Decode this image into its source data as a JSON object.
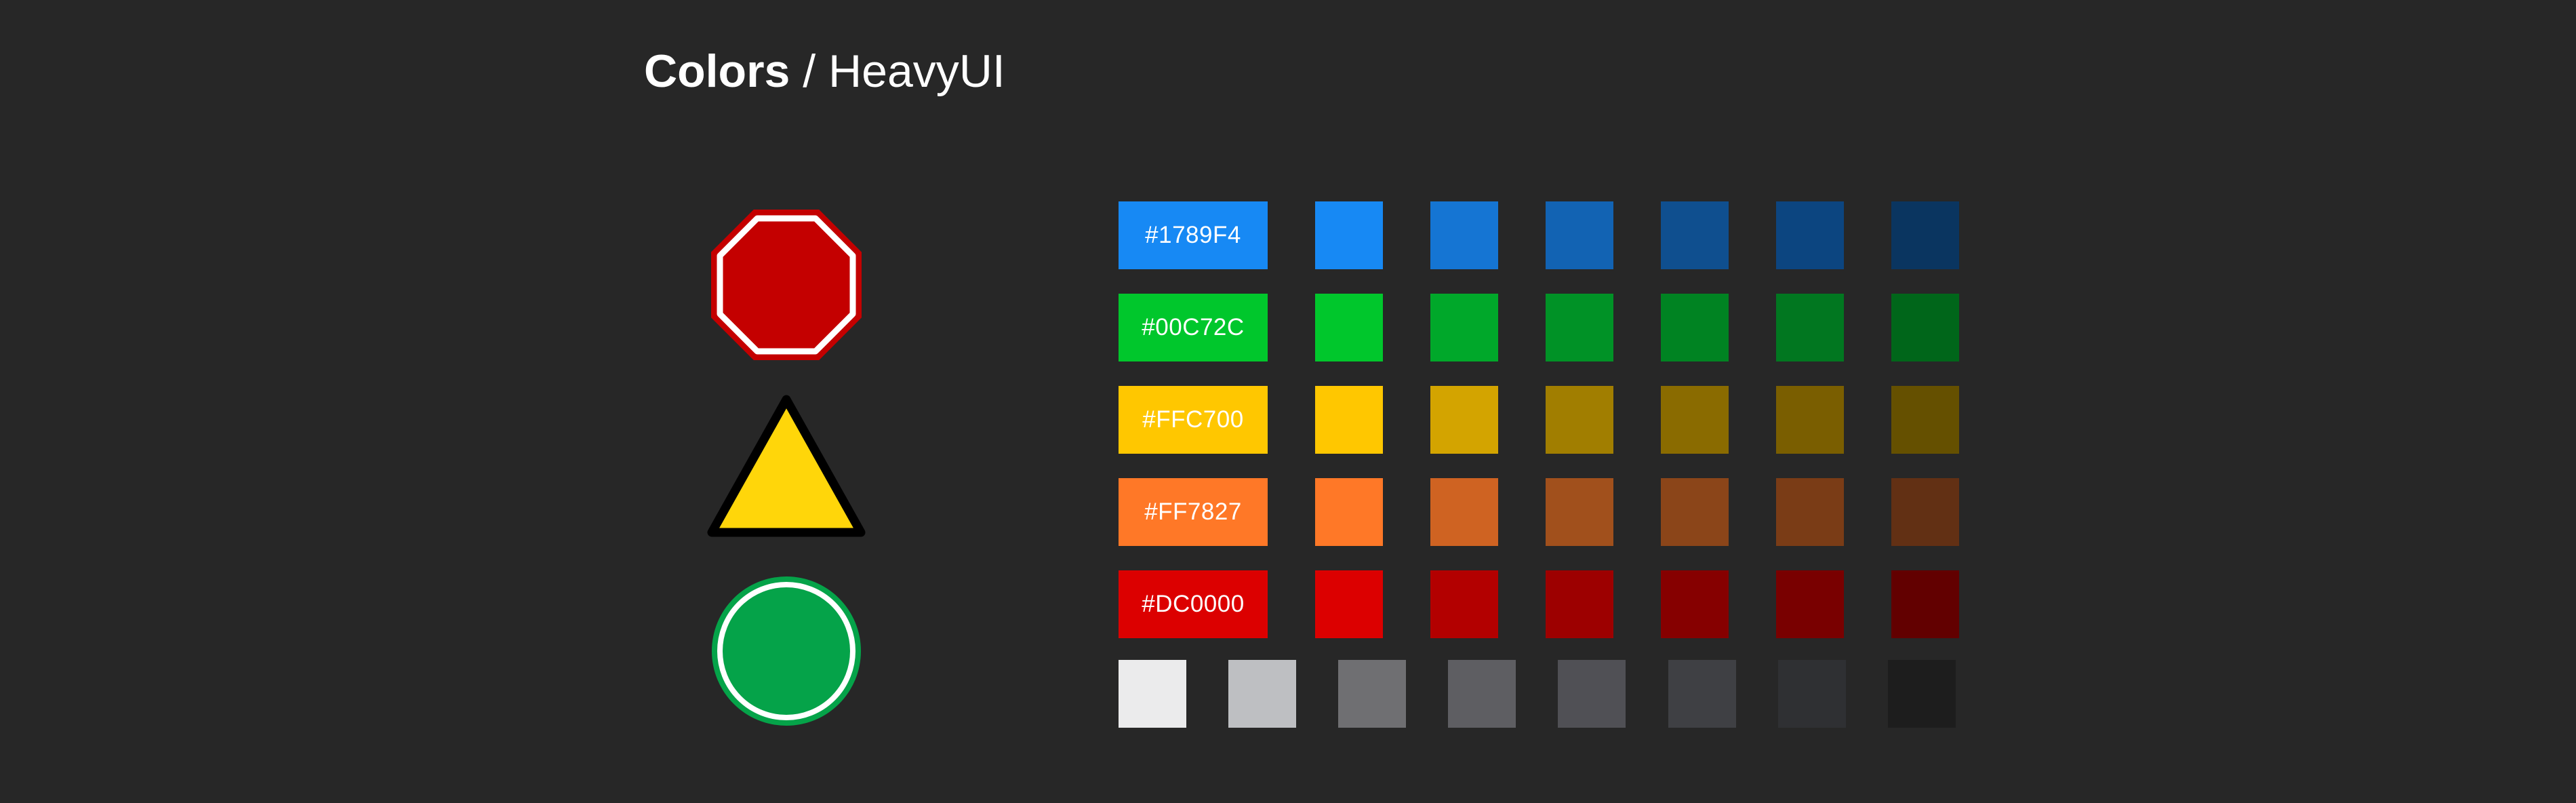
{
  "header": {
    "title_bold": "Colors",
    "title_separator": " / ",
    "title_light": "HeavyUI"
  },
  "signs": [
    {
      "icon": "stop-sign-icon",
      "fill": "#C40000",
      "stroke": "#FFFFFF",
      "outline": "#C40000"
    },
    {
      "icon": "warning-triangle-icon",
      "fill": "#FFD60A",
      "stroke": "#000000"
    },
    {
      "icon": "go-circle-icon",
      "fill": "#05A349",
      "stroke": "#FFFFFF",
      "outline": "#05A349"
    }
  ],
  "palette": [
    {
      "label": "#1789F4",
      "base": "#1789F4",
      "shades": [
        "#1789F4",
        "#1575D3",
        "#1263B3",
        "#0F4F8F",
        "#0C4580",
        "#0A3560"
      ]
    },
    {
      "label": "#00C72C",
      "base": "#00C72C",
      "shades": [
        "#00C72C",
        "#00A82A",
        "#009226",
        "#008322",
        "#017720",
        "#00661A"
      ]
    },
    {
      "label": "#FFC700",
      "base": "#FFC700",
      "shades": [
        "#FFC700",
        "#D3A400",
        "#A17E00",
        "#8A6B00",
        "#7A5E00",
        "#655000"
      ]
    },
    {
      "label": "#FF7827",
      "base": "#FF7827",
      "shades": [
        "#FF7827",
        "#CF6322",
        "#A1501C",
        "#8B4519",
        "#7A3C16",
        "#623014"
      ]
    },
    {
      "label": "#DC0000",
      "base": "#DC0000",
      "shades": [
        "#DC0000",
        "#B30000",
        "#9D0000",
        "#860000",
        "#790000",
        "#620000"
      ]
    }
  ],
  "grays": [
    "#EBEBEC",
    "#BEBFC2",
    "#6F6F72",
    "#5E5E62",
    "#505055",
    "#3F4044",
    "#2F3033",
    "#1D1D1D"
  ]
}
